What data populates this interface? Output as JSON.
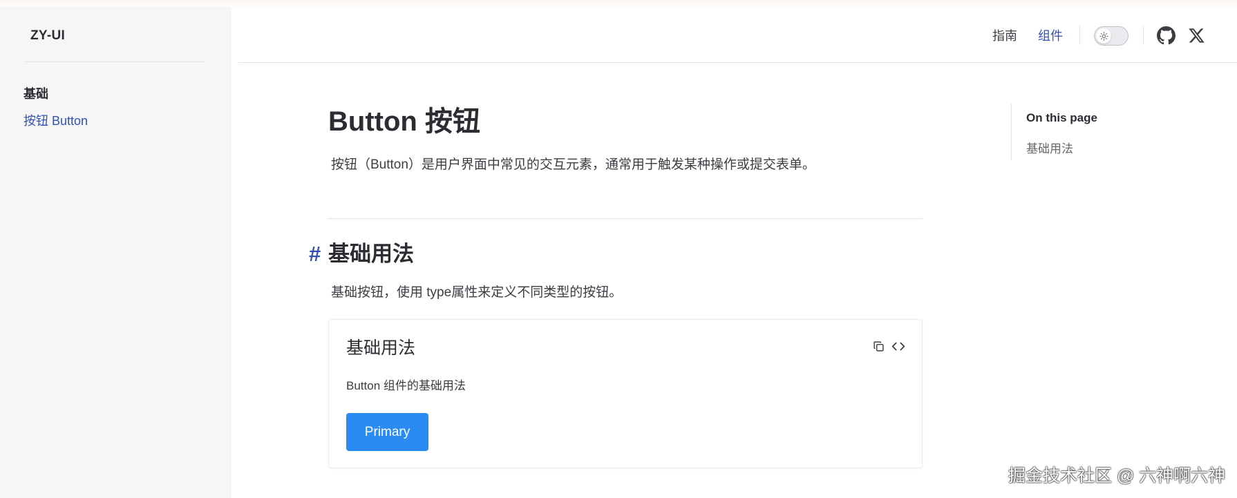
{
  "sidebar": {
    "brand": "ZY-UI",
    "group_title": "基础",
    "items": [
      {
        "label": "按钮 Button",
        "active": true
      }
    ]
  },
  "navbar": {
    "links": [
      {
        "label": "指南",
        "active": false
      },
      {
        "label": "组件",
        "active": true
      }
    ],
    "icons": [
      "sun-icon",
      "github-icon",
      "x-twitter-icon"
    ]
  },
  "content": {
    "title": "Button 按钮",
    "description": "按钮（Button）是用户界面中常见的交互元素，通常用于触发某种操作或提交表单。",
    "sections": [
      {
        "anchor": "#",
        "heading": "基础用法",
        "description": "基础按钮，使用 type属性来定义不同类型的按钮。",
        "demo": {
          "title": "基础用法",
          "description": "Button 组件的基础用法",
          "actions": [
            "copy-icon",
            "code-icon"
          ],
          "button_label": "Primary"
        }
      }
    ]
  },
  "outline": {
    "title": "On this page",
    "items": [
      "基础用法"
    ]
  },
  "watermark": "掘金技术社区 @ 六神啊六神",
  "colors": {
    "accent": "#3451b2",
    "primary_button": "#2a8cf3",
    "sidebar_bg": "#f6f6f7",
    "text": "#3c3c43",
    "heading": "#2c2c32"
  }
}
